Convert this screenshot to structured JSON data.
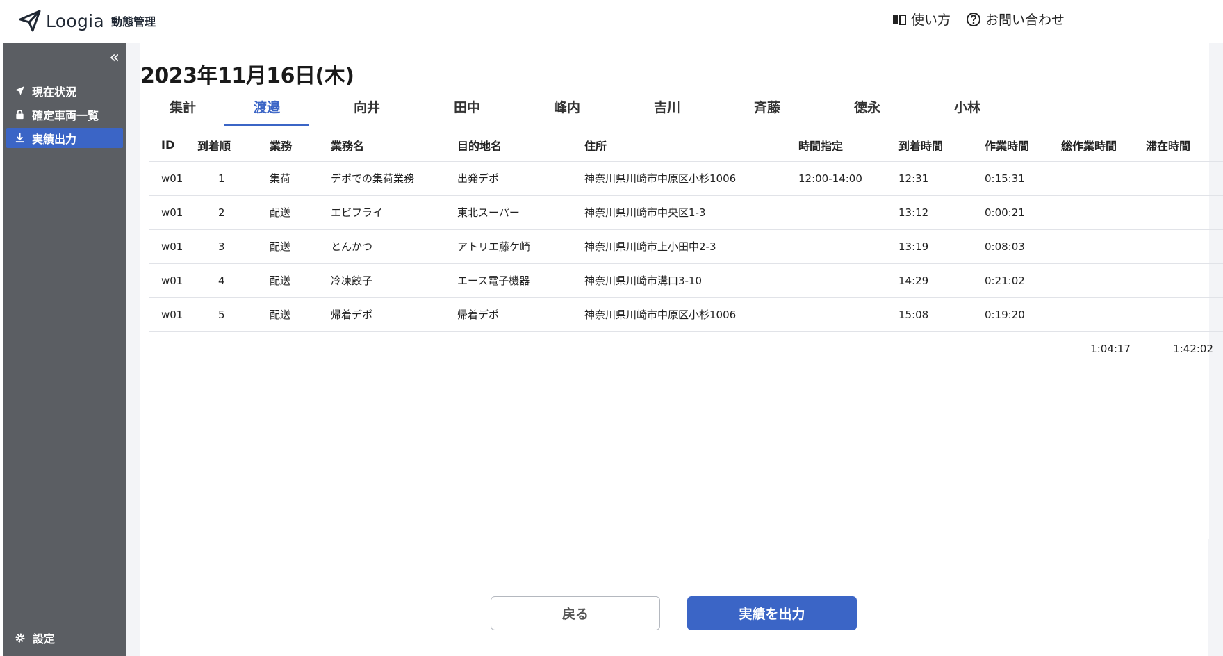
{
  "header": {
    "logo_text": "Loogia",
    "logo_sub": "動態管理",
    "help_label": "使い方",
    "contact_label": "お問い合わせ"
  },
  "sidebar": {
    "collapse_icon": "«",
    "items": [
      {
        "label": "現在状況",
        "icon": "navigation-arrow-icon",
        "active": false
      },
      {
        "label": "確定車両一覧",
        "icon": "lock-icon",
        "active": false
      },
      {
        "label": "実績出力",
        "icon": "download-icon",
        "active": true
      }
    ],
    "settings_label": "設定"
  },
  "main": {
    "date_title": "2023年11月16日(木)",
    "tabs": [
      "集計",
      "渡邉",
      "向井",
      "田中",
      "峰内",
      "吉川",
      "斉藤",
      "徳永",
      "小林"
    ],
    "active_tab": "渡邉",
    "table": {
      "headers": [
        "ID",
        "到着順",
        "業務",
        "業務名",
        "目的地名",
        "住所",
        "時間指定",
        "到着時間",
        "作業時間",
        "総作業時間",
        "滞在時間"
      ],
      "rows": [
        [
          "w01",
          "1",
          "集荷",
          "デポでの集荷業務",
          "出発デポ",
          "神奈川県川崎市中原区小杉1006",
          "12:00-14:00",
          "12:31",
          "0:15:31",
          "",
          ""
        ],
        [
          "w01",
          "2",
          "配送",
          "エビフライ",
          "東北スーパー",
          "神奈川県川崎市中央区1-3",
          "",
          "13:12",
          "0:00:21",
          "",
          ""
        ],
        [
          "w01",
          "3",
          "配送",
          "とんかつ",
          "アトリエ藤ケ崎",
          "神奈川県川崎市上小田中2-3",
          "",
          "13:19",
          "0:08:03",
          "",
          ""
        ],
        [
          "w01",
          "4",
          "配送",
          "冷凍餃子",
          "エース電子機器",
          "神奈川県川崎市溝口3-10",
          "",
          "14:29",
          "0:21:02",
          "",
          ""
        ],
        [
          "w01",
          "5",
          "配送",
          "帰着デポ",
          "帰着デポ",
          "神奈川県川崎市中原区小杉1006",
          "",
          "15:08",
          "0:19:20",
          "",
          ""
        ]
      ],
      "totals": {
        "total_work": "1:04:17",
        "stay_time": "1:42:02"
      }
    },
    "back_button": "戻る",
    "export_button": "実績を出力"
  },
  "colors": {
    "accent": "#3b65c6",
    "sidebar": "#5b5e63",
    "background": "#f3f4f7"
  }
}
